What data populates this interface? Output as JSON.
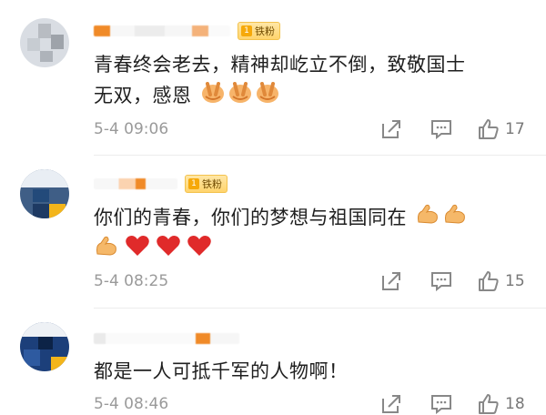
{
  "comments": [
    {
      "badge": "铁粉",
      "badge_level": "1",
      "text_line1": "青春终会老去，精神却屹立不倒，致敬国士",
      "text_line2": "无双，感恩",
      "emojis": [
        "pray",
        "pray",
        "pray"
      ],
      "time": "5-4 09:06",
      "likes": "17"
    },
    {
      "badge": "铁粉",
      "badge_level": "1",
      "text_line1": "你们的青春，你们的梦想与祖国同在",
      "emojis_line1": [
        "muscle",
        "muscle"
      ],
      "emojis_line2": [
        "muscle",
        "heart",
        "heart",
        "heart"
      ],
      "time": "5-4 08:25",
      "likes": "15"
    },
    {
      "text_line1": "都是一人可抵千军的人物啊！",
      "time": "5-4 08:46",
      "likes": "18"
    }
  ],
  "colors": {
    "accent": "#f08a28",
    "badge_bg": "#ffd46d",
    "heart": "#e02a2a",
    "meta_text": "#9a9a9a"
  },
  "icons": [
    "share-icon",
    "comment-icon",
    "like-icon",
    "pray-emoji",
    "muscle-emoji",
    "heart-emoji"
  ]
}
